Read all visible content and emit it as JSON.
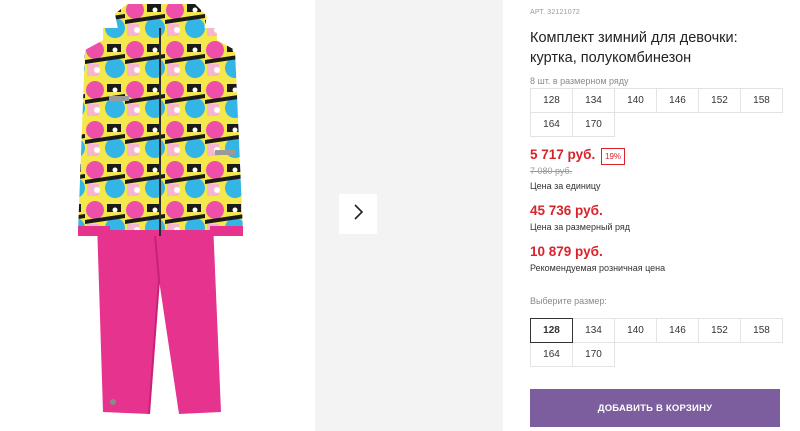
{
  "product": {
    "art_label": "АРТ.",
    "art_number": "32121072",
    "title": "Комплект зимний для девочки: куртка, полукомбинезон"
  },
  "size_row": {
    "note": "8 шт. в размерном ряду",
    "sizes": [
      "128",
      "134",
      "140",
      "146",
      "152",
      "158",
      "164",
      "170"
    ]
  },
  "prices": {
    "unit_price": "5 717 руб.",
    "discount": "19%",
    "old_price": "7 080 руб.",
    "unit_caption": "Цена за единицу",
    "row_price": "45 736 руб.",
    "row_caption": "Цена за размерный ряд",
    "retail_price": "10 879 руб.",
    "retail_caption": "Рекомендуемая розничная цена"
  },
  "size_select": {
    "label": "Выберите размер:",
    "options": [
      "128",
      "134",
      "140",
      "146",
      "152",
      "158",
      "164",
      "170"
    ],
    "selected": "128"
  },
  "cart_button": {
    "label": "ДОБАВИТЬ В КОРЗИНУ"
  },
  "colors": {
    "price_red": "#d9222a",
    "button_purple": "#7c5e9e",
    "pants_pink": "#e6338e"
  },
  "icons": {
    "next": "chevron-right-icon"
  }
}
